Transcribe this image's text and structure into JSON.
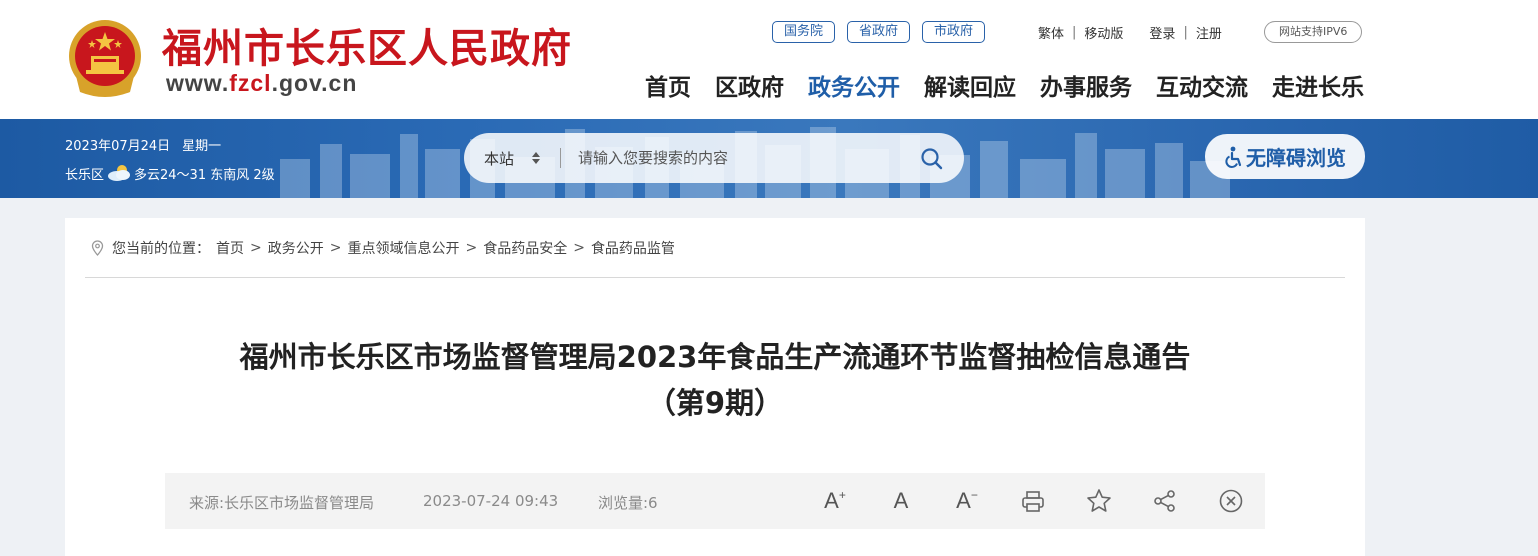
{
  "header": {
    "site_title": "福州市长乐区人民政府",
    "url_prefix": "www.",
    "url_highlight": "fzcl",
    "url_suffix": ".gov.cn",
    "gov_links": [
      "国务院",
      "省政府",
      "市政府"
    ],
    "util_links": [
      "繁体",
      "移动版"
    ],
    "auth_links": [
      "登录",
      "注册"
    ],
    "ipv6_label": "网站支持IPV6",
    "nav": [
      "首页",
      "区政府",
      "政务公开",
      "解读回应",
      "办事服务",
      "互动交流",
      "走进长乐"
    ],
    "active_nav": "政务公开",
    "brand_color": "#c8161d",
    "accent_color": "#1f5ea8"
  },
  "banner": {
    "date": "2023年07月24日",
    "weekday": "星期一",
    "location": "长乐区",
    "weather": "多云24～31 东南风 2级",
    "search_scope": "本站",
    "search_placeholder": "请输入您要搜索的内容",
    "accessibility_label": "无障碍浏览"
  },
  "breadcrumb": {
    "prefix": "您当前的位置：",
    "items": [
      "首页",
      "政务公开",
      "重点领域信息公开",
      "食品药品安全",
      "食品药品监管"
    ]
  },
  "article": {
    "title_line1": "福州市长乐区市场监督管理局2023年食品生产流通环节监督抽检信息通告",
    "title_line2": "（第9期）",
    "source": "来源:长乐区市场监督管理局",
    "datetime": "2023-07-24 09:43",
    "views": "浏览量:6"
  },
  "tools": {
    "font_increase": "A",
    "font_normal": "A",
    "font_decrease": "A",
    "icons": [
      "font-increase-icon",
      "font-normal-icon",
      "font-decrease-icon",
      "print-icon",
      "favorite-star-icon",
      "share-icon",
      "close-icon"
    ]
  }
}
